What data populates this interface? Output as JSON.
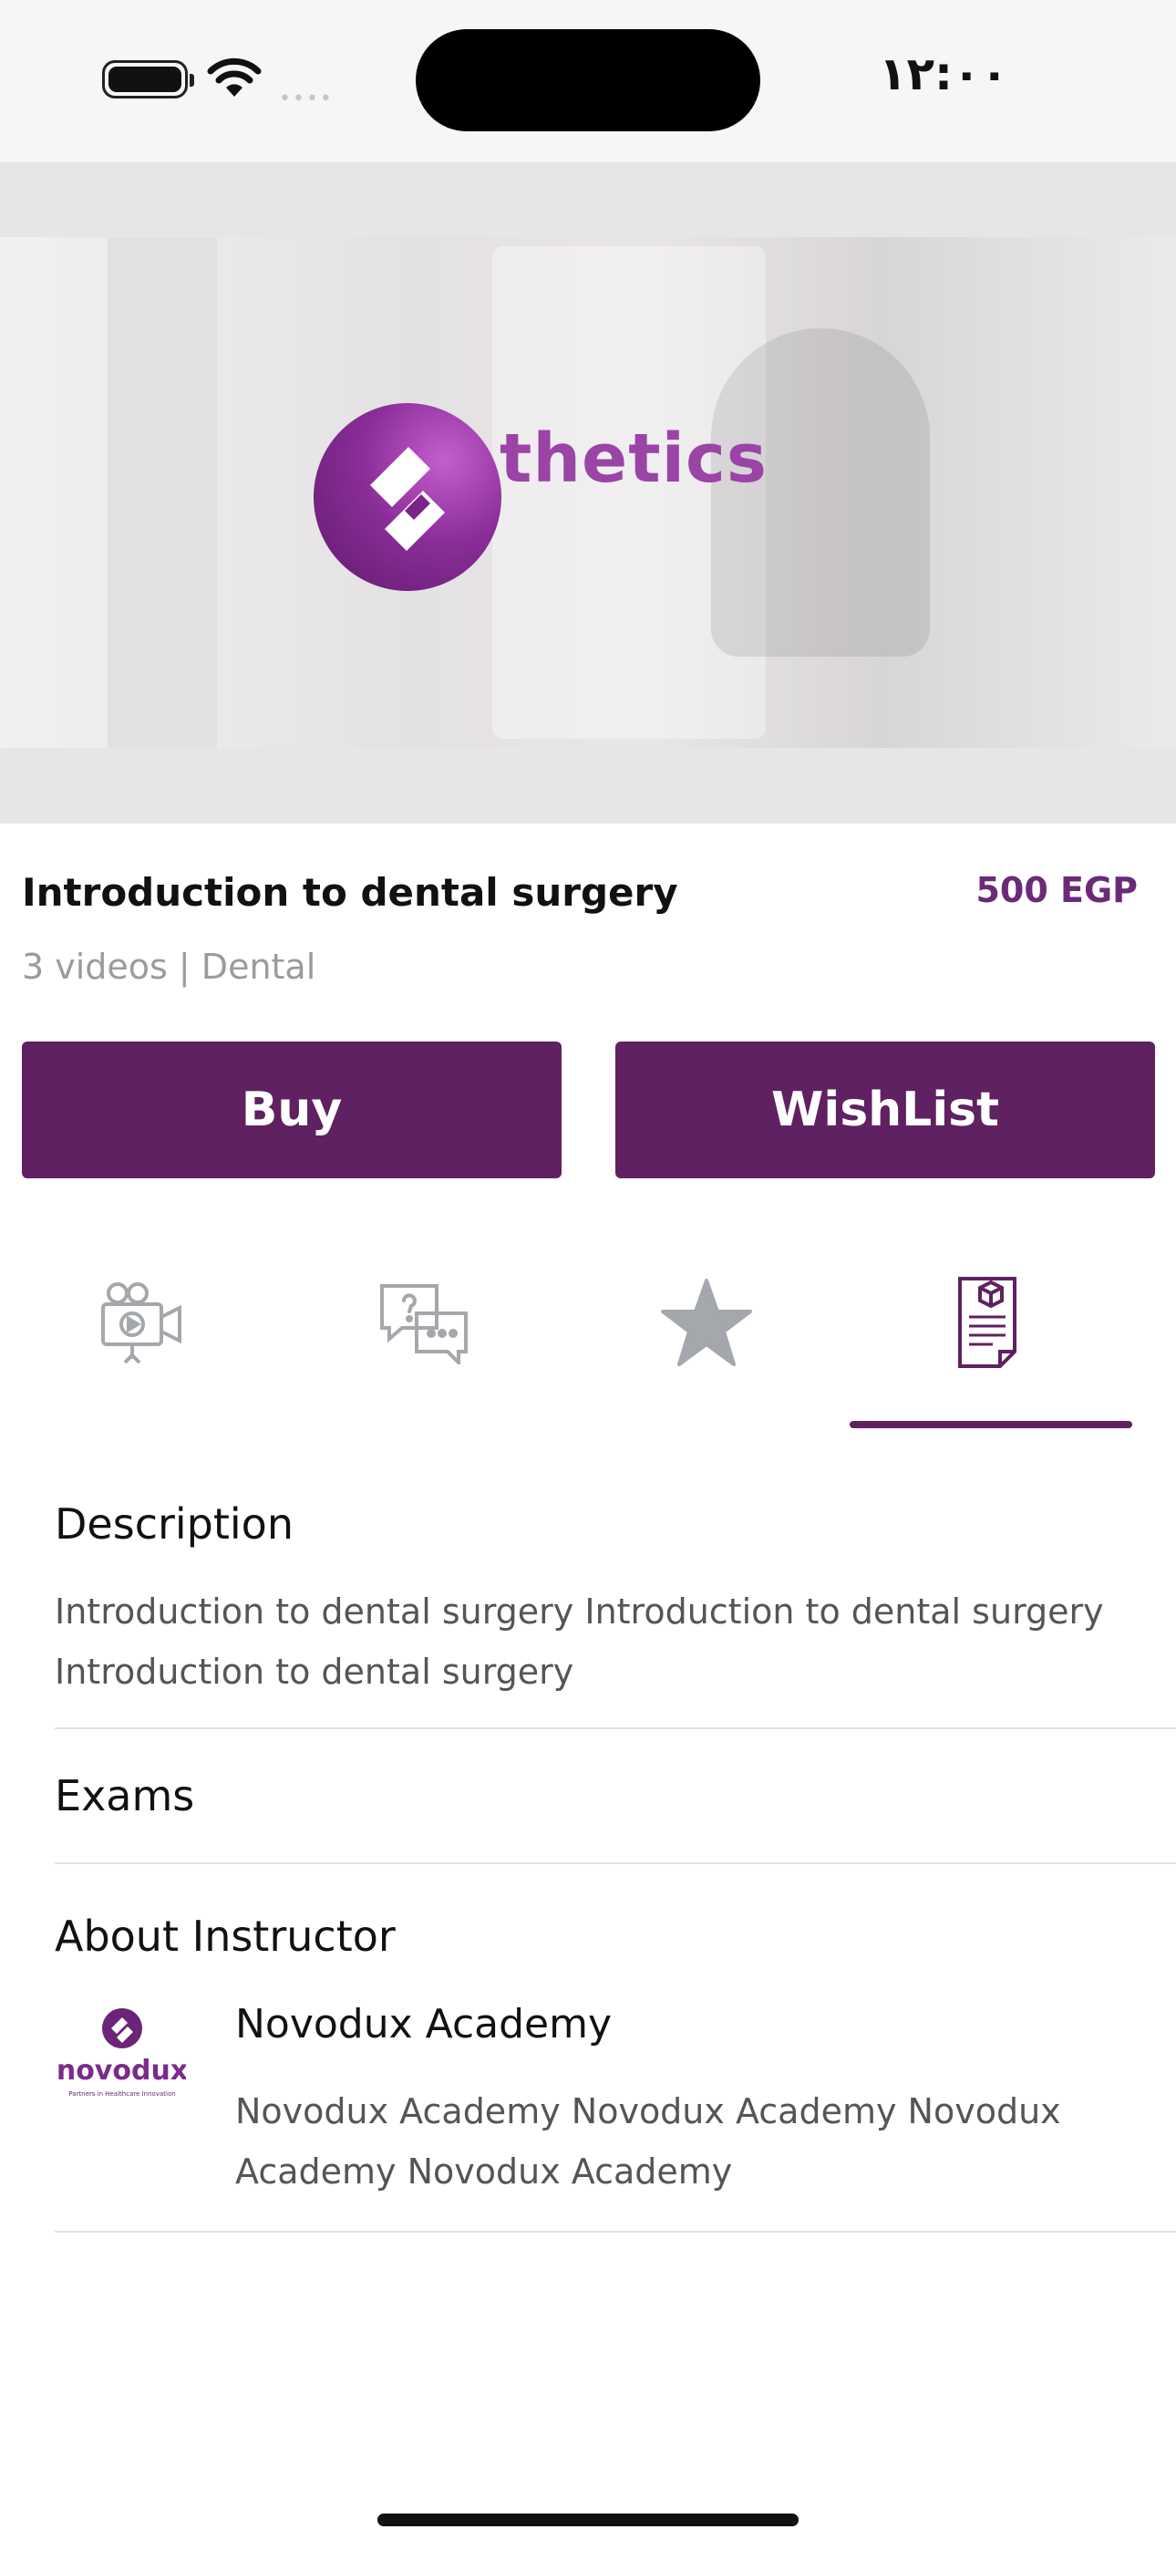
{
  "status_bar": {
    "time": "١٢:٠٠",
    "signal_dots": "••••",
    "icons": [
      "battery-icon",
      "wifi-icon"
    ]
  },
  "hero": {
    "logo_text": "thetics",
    "icon": "play-video-thumbnail"
  },
  "course": {
    "title": "Introduction to dental surgery",
    "price": "500 EGP",
    "meta": "3 videos | Dental"
  },
  "actions": {
    "buy_label": "Buy",
    "wishlist_label": "WishList"
  },
  "tabs": [
    {
      "icon": "video-camera-icon",
      "active": false
    },
    {
      "icon": "question-chat-icon",
      "active": false
    },
    {
      "icon": "star-icon",
      "active": false
    },
    {
      "icon": "document-icon",
      "active": true
    }
  ],
  "details": {
    "description_heading": "Description",
    "description_text": "Introduction to dental surgery Introduction to dental surgery Introduction to dental surgery",
    "exams_heading": "Exams",
    "about_heading": "About Instructor"
  },
  "instructor": {
    "logo_wordmark": "novodux",
    "logo_tagline": "Partners in Healthcare Innovation",
    "name": "Novodux Academy",
    "bio": "Novodux Academy Novodux Academy Novodux Academy Novodux Academy"
  },
  "colors": {
    "brand_purple": "#5f2161",
    "price_purple": "#6a2a79",
    "muted_text": "#9b9b9b",
    "tab_icon_gray": "#a4a7ab"
  }
}
